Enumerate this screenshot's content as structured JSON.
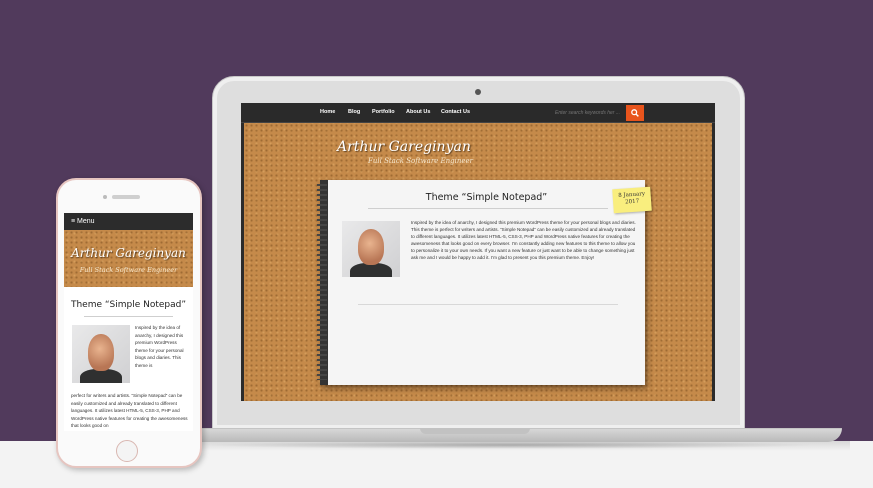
{
  "desktop": {
    "nav": {
      "items": [
        {
          "label": "Home"
        },
        {
          "label": "Blog"
        },
        {
          "label": "Portfolio"
        },
        {
          "label": "About Us"
        },
        {
          "label": "Contact Us"
        }
      ],
      "search_placeholder": "Enter search keywords her ...",
      "search_icon": "search-icon"
    },
    "brand": "Arthur Gareginyan",
    "tagline": "Full Stack Software Engineer",
    "post": {
      "title": "Theme “Simple Notepad”",
      "date_line1": "8 January",
      "date_line2": "2017",
      "body": "Inspired by the idea of anarchy, I designed this premium WordPress theme for your personal blogs and diaries. This theme is perfect for writers and artists. “Simple Notepad” can be easily customized and already translated to different languages. It utilizes latest HTML-5, CSS-3, PHP and WordPress native features for creating the awesomeness that looks good on every browser. I'm constantly adding new features to this theme to allow you to personalize it to your own needs. If you want a new feature or just want to be able to change something just ask me and I would be happy to add it. I'm glad to present you this premium theme. Enjoy!"
    }
  },
  "mobile": {
    "menu_label": "≡ Menu",
    "brand": "Arthur Gareginyan",
    "tagline": "Full Stack Software Engineer",
    "post_title": "Theme “Simple Notepad”",
    "body_right": "Inspired by the idea of anarchy, I designed this premium WordPress theme for your personal blogs and diaries. This theme is",
    "body_full": "perfect for writers and artists. “Simple Notepad” can be easily customized and already translated to different languages. It utilizes latest HTML-5, CSS-3, PHP and WordPress native features for creating the awesomeness that looks good on"
  },
  "colors": {
    "background": "#513a5c",
    "nav": "#2a2a2a",
    "search_button": "#e8541c",
    "cork": "#c58a4a",
    "sticky_note": "#f9ee7e"
  }
}
